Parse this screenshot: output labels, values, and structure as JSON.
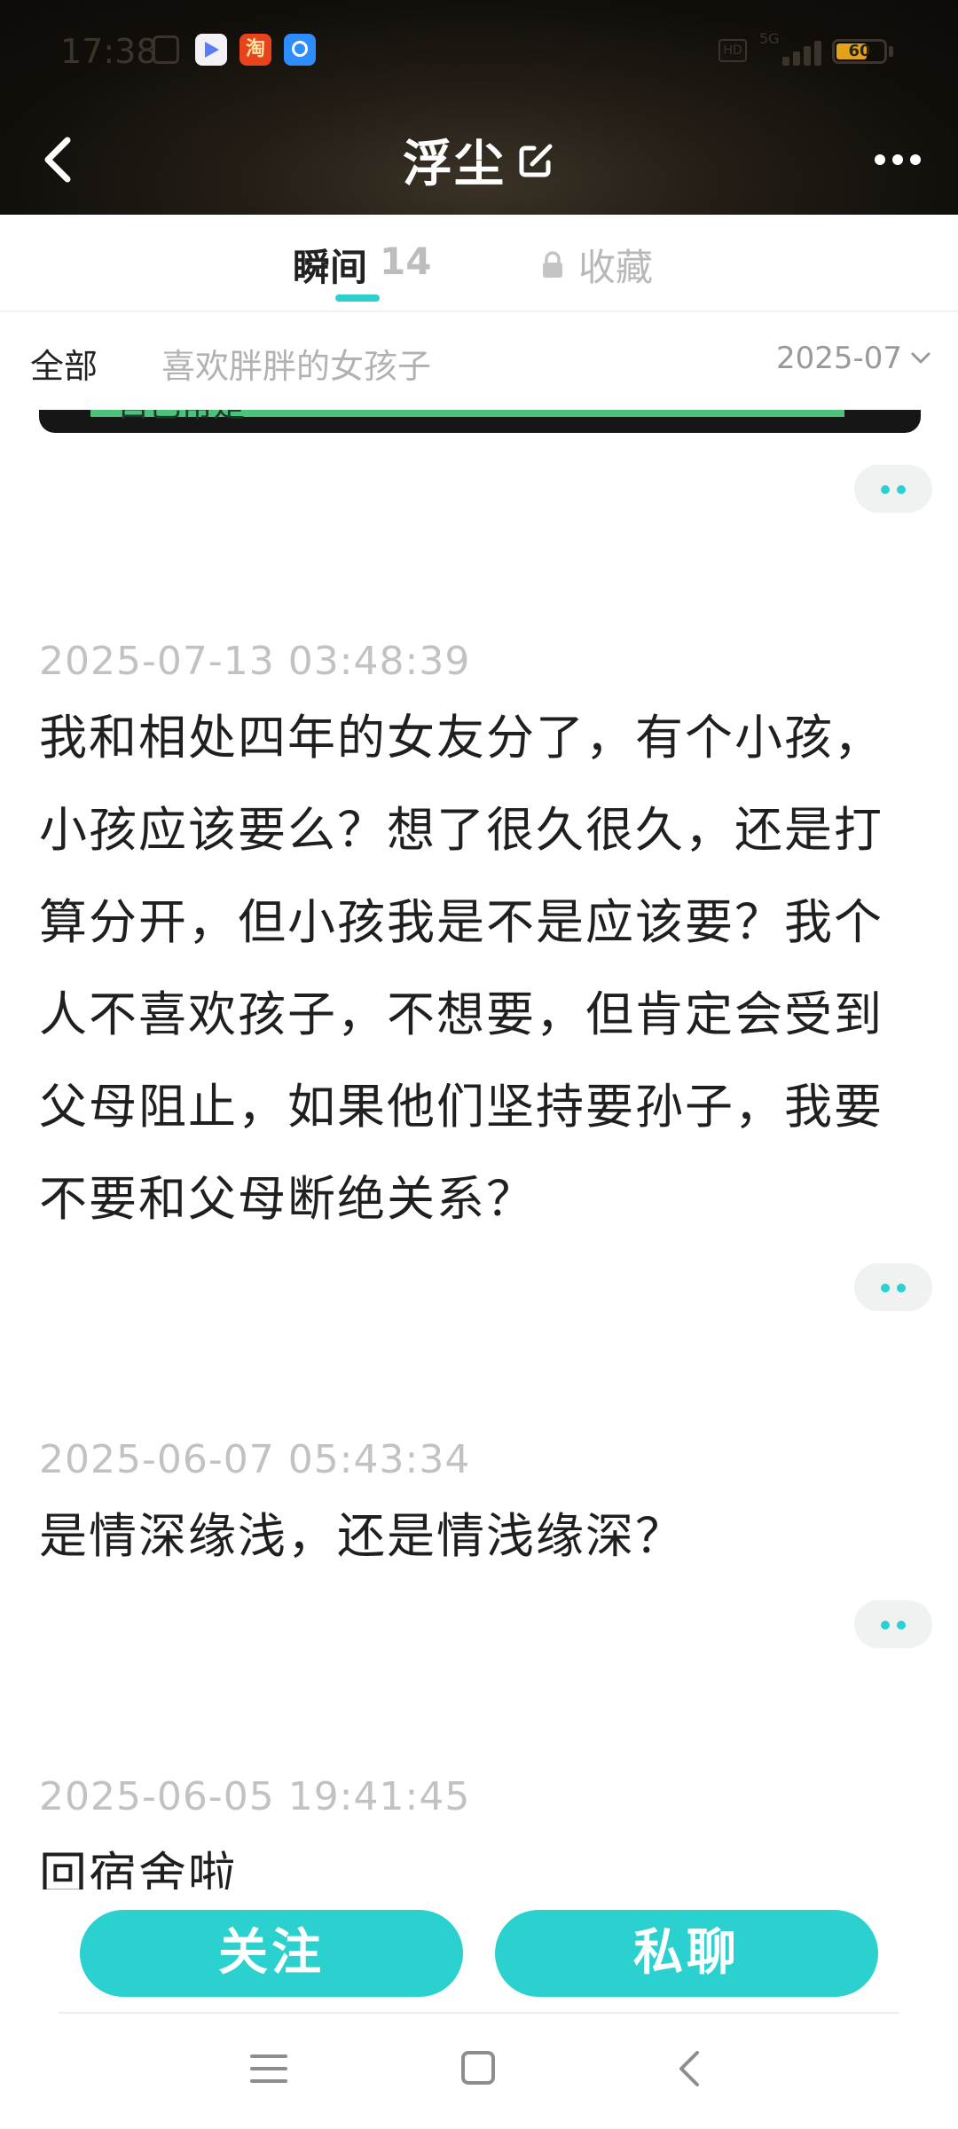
{
  "status_bar": {
    "time": "17:38",
    "battery": "60",
    "network": "5G",
    "hd": "HD",
    "app2_text": "淘"
  },
  "header": {
    "title": "浮尘"
  },
  "tabs": {
    "moments_label": "瞬间",
    "moments_count": "14",
    "favorites_label": "收藏"
  },
  "filter": {
    "all_label": "全部",
    "tag_label": "喜欢胖胖的女孩子",
    "date_label": "2025-07"
  },
  "feed": {
    "media_caption": "自己常是",
    "posts": [
      {
        "time": "2025-07-13 03:48:39",
        "lines": [
          "我和相处四年的女友分了，有个小孩，",
          "小孩应该要么？想了很久很久，还是打",
          "算分开，但小孩我是不是应该要？我个",
          "人不喜欢孩子，不想要，但肯定会受到",
          "父母阻止，如果他们坚持要孙子，我要",
          "不要和父母断绝关系？"
        ]
      },
      {
        "time": "2025-06-07 05:43:34",
        "lines": [
          "是情深缘浅，还是情浅缘深？"
        ]
      },
      {
        "time": "2025-06-05 19:41:45",
        "lines": [
          "回宿舍啦"
        ]
      }
    ]
  },
  "actions": {
    "follow_label": "关注",
    "chat_label": "私聊"
  },
  "colors": {
    "accent": "#2bd1cf",
    "header_bg": "#1a1510",
    "timestamp": "#c2c2c2"
  },
  "icons": [
    "back-arrow-icon",
    "edit-icon",
    "more-dots-icon",
    "lock-icon",
    "chevron-down-icon",
    "menu-icon",
    "home-icon",
    "nav-back-icon"
  ]
}
